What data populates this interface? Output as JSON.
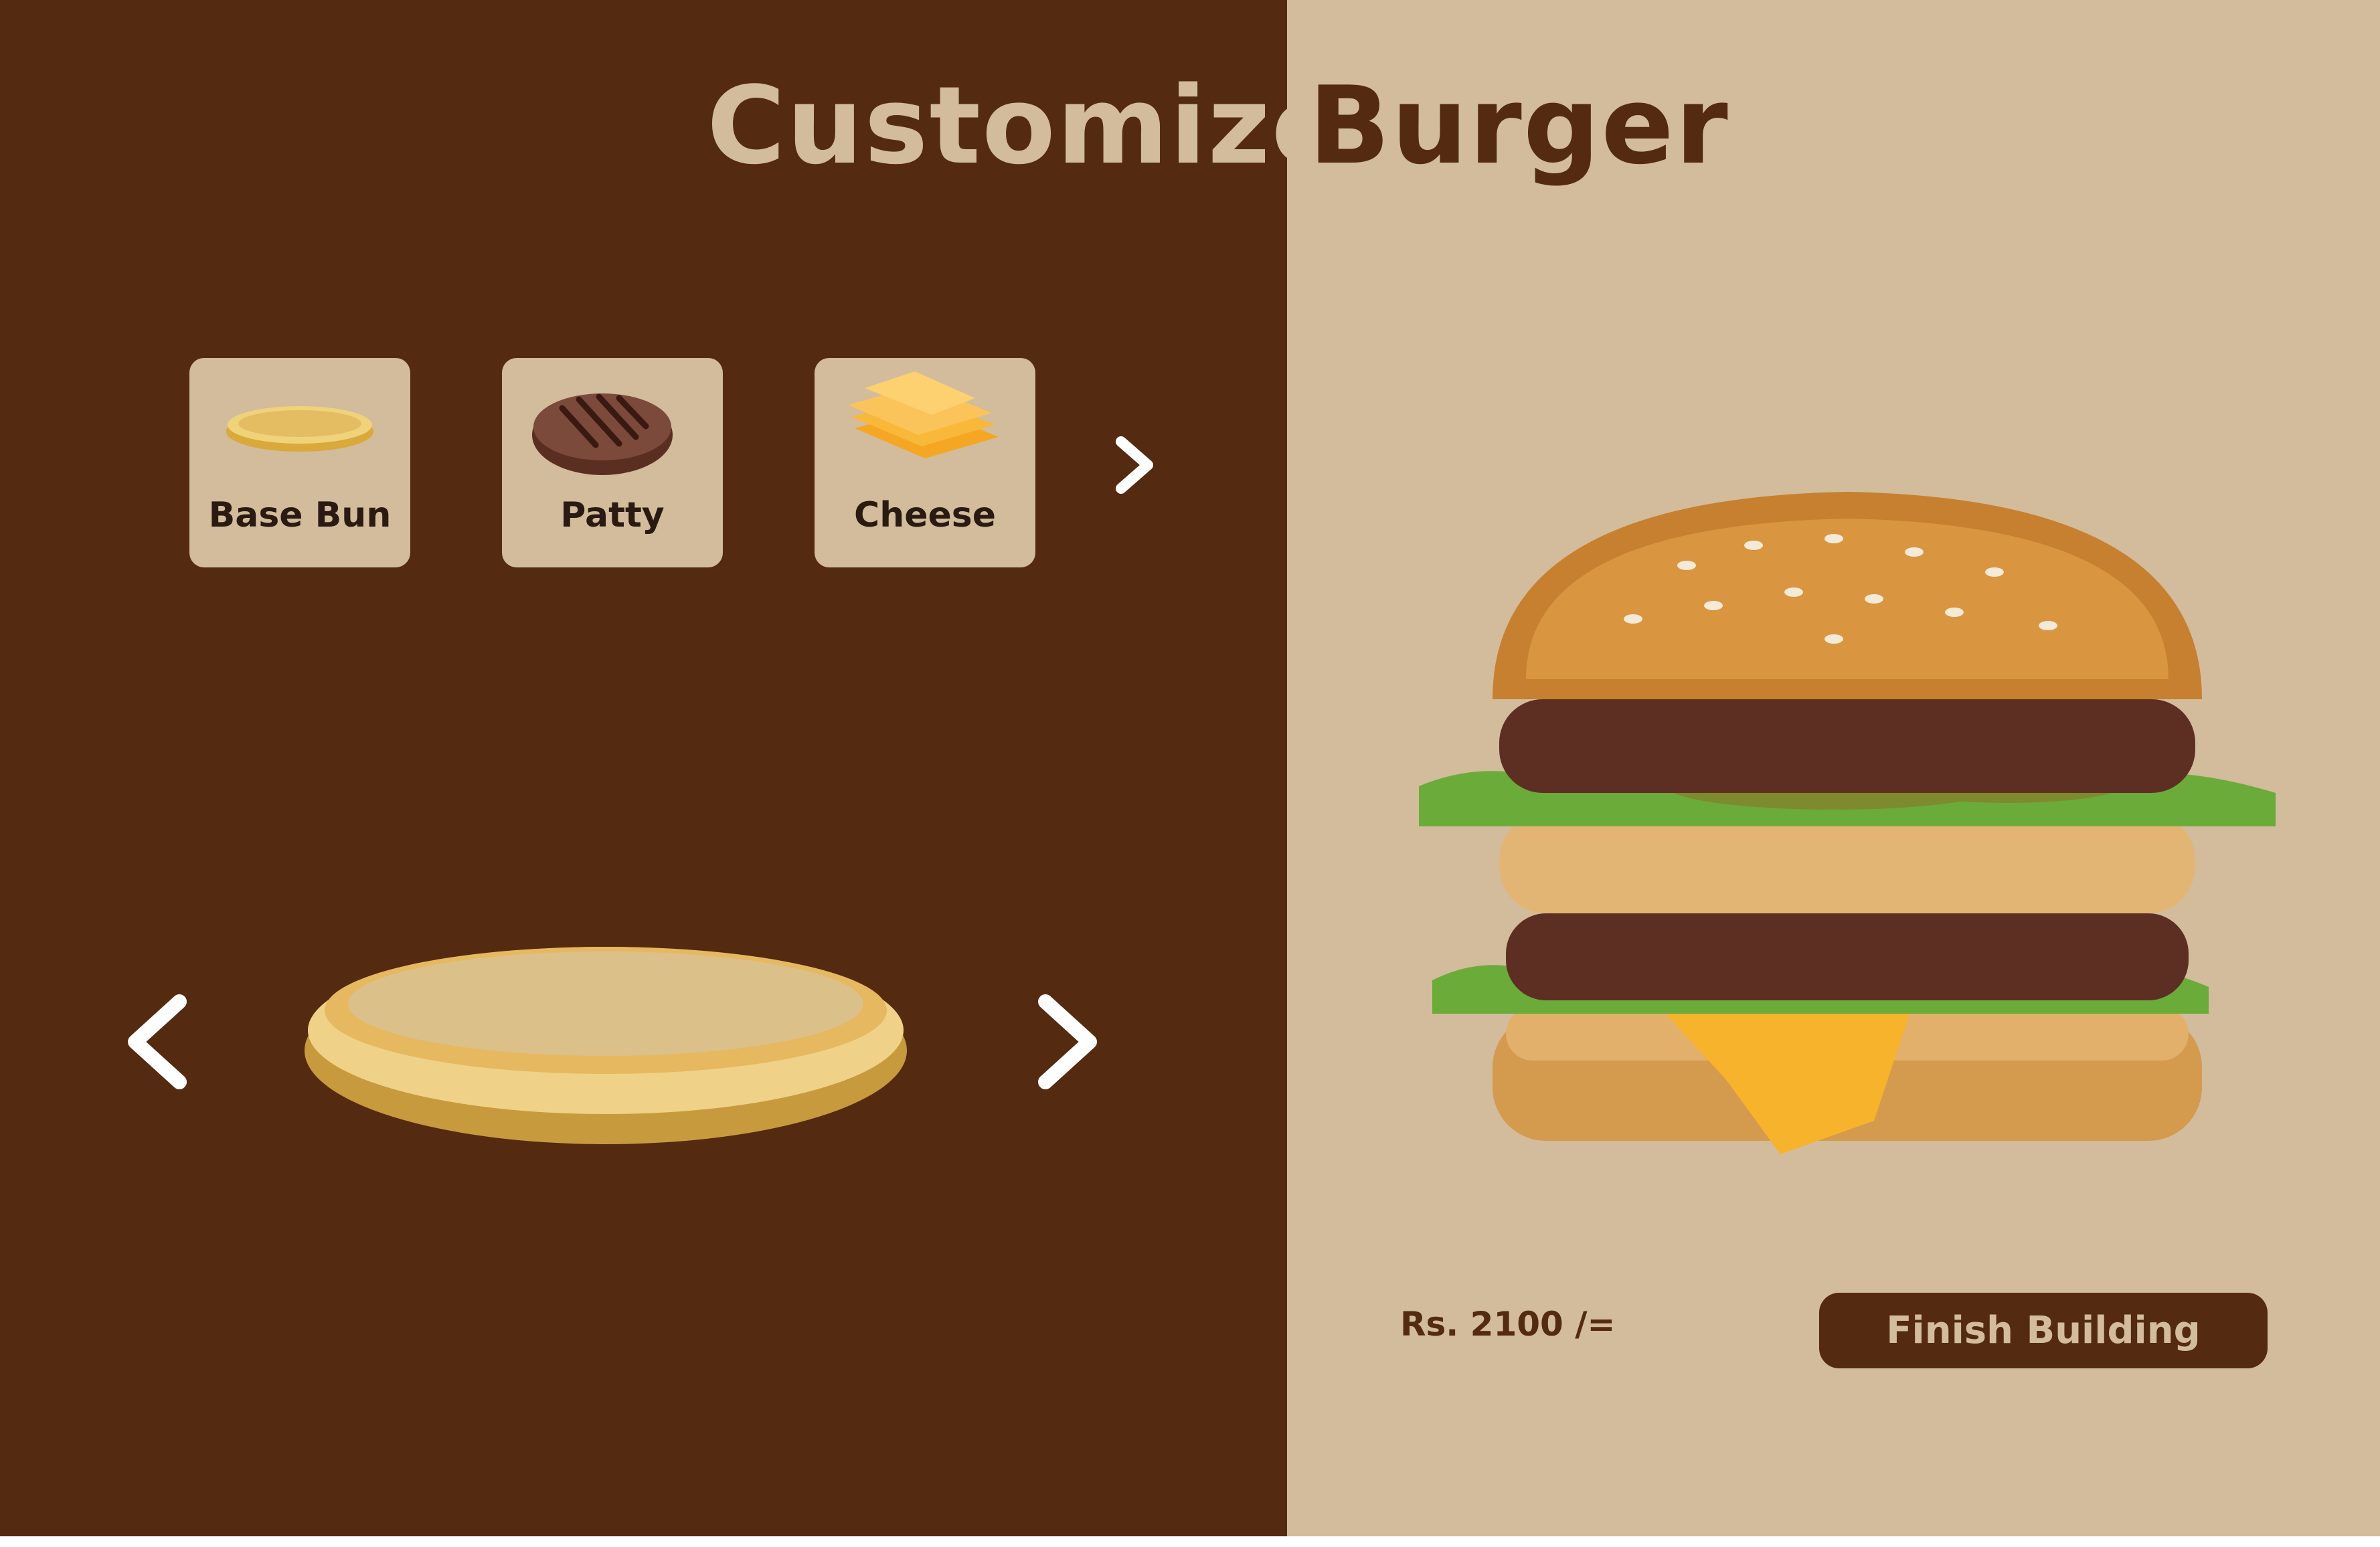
{
  "title": {
    "left": "Customize",
    "right": "Burger"
  },
  "ingredients": [
    {
      "label": "Base Bun",
      "icon": "bun-icon"
    },
    {
      "label": "Patty",
      "icon": "patty-icon"
    },
    {
      "label": "Cheese",
      "icon": "cheese-icon"
    }
  ],
  "carousel": {
    "prev_icon": "chevron-left-icon",
    "next_icon": "chevron-right-icon"
  },
  "summary": {
    "price": "Rs. 2100 /=",
    "finish_label": "Finish Building"
  },
  "colors": {
    "brown": "#542a11",
    "tan": "#d2bc9c"
  }
}
